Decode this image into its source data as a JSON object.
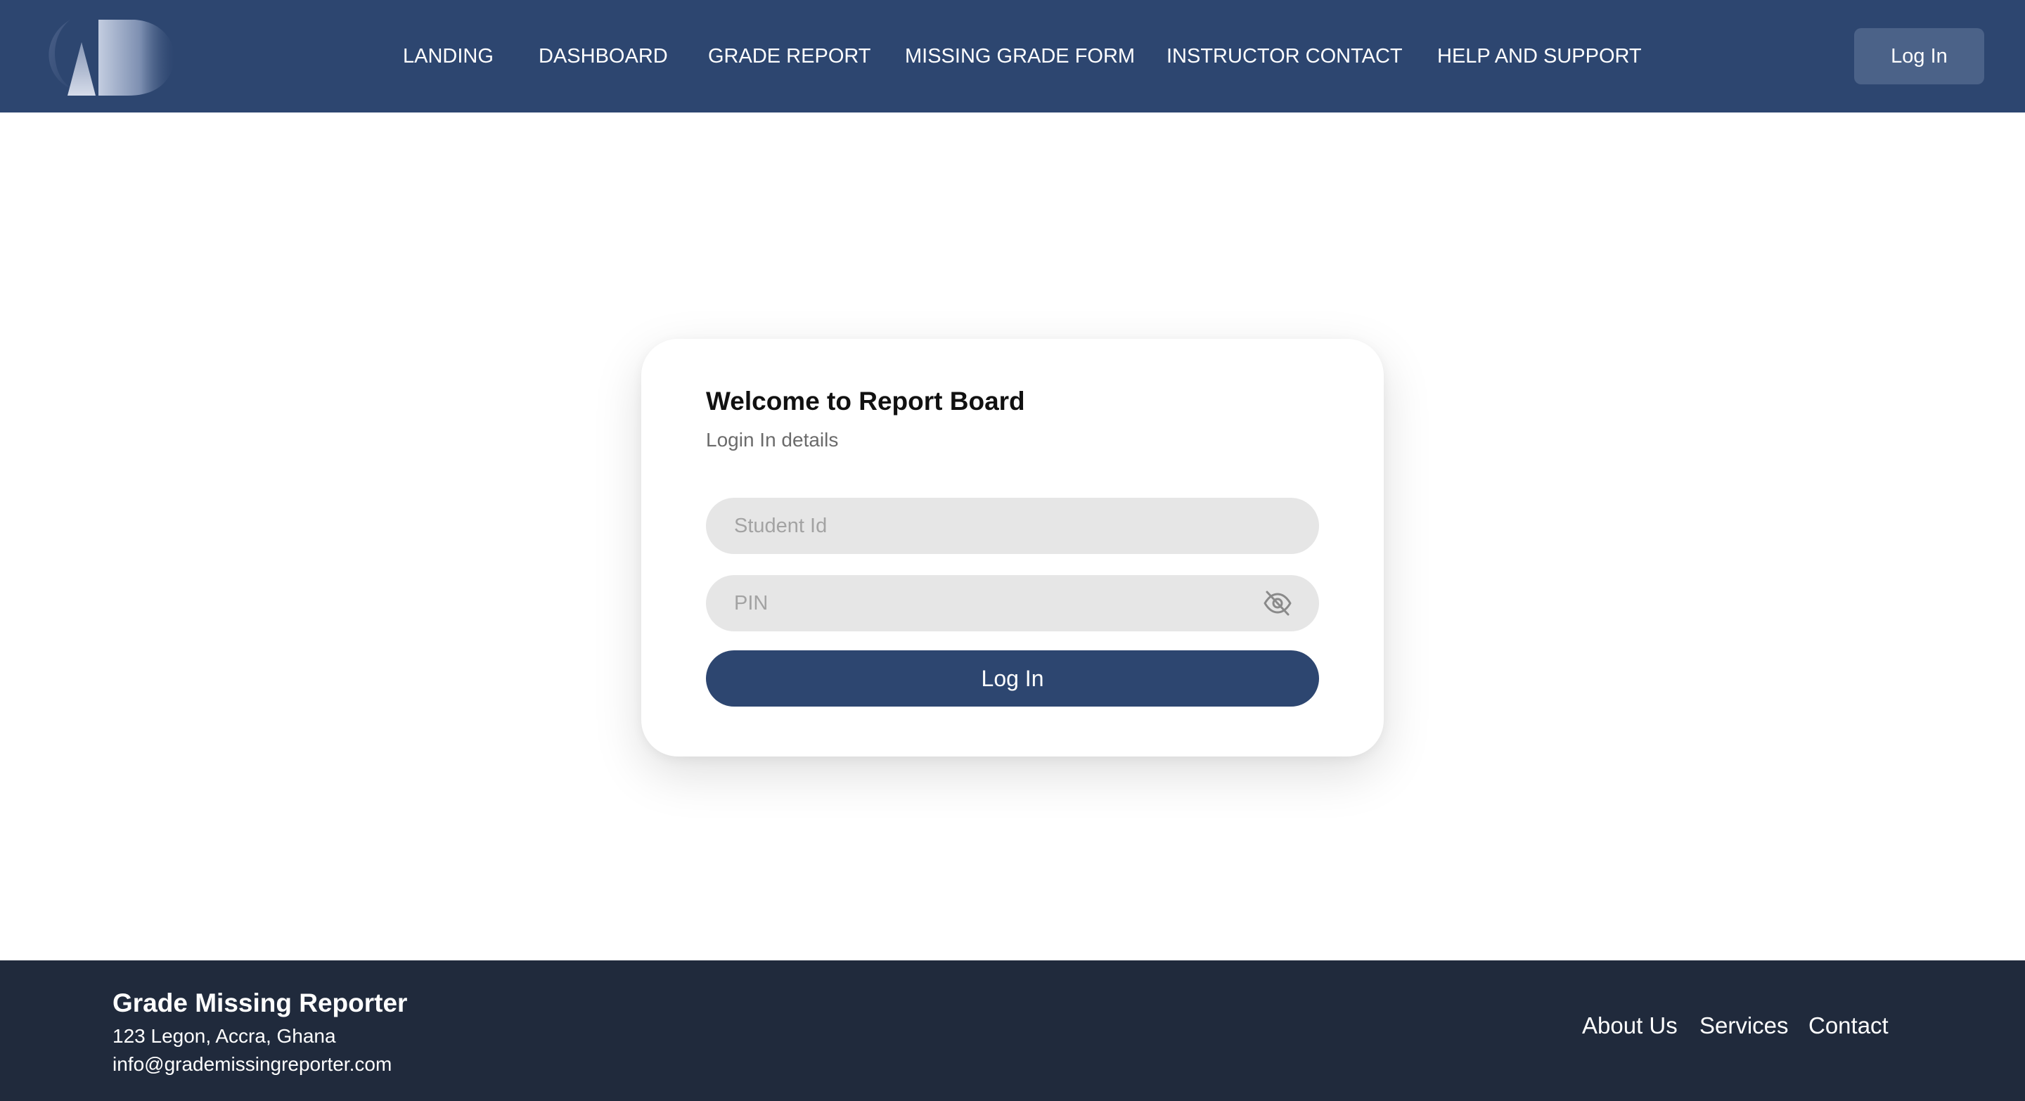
{
  "header": {
    "logo_icon": "brand-logo-icon",
    "nav": [
      {
        "label": "LANDING"
      },
      {
        "label": "DASHBOARD"
      },
      {
        "label": "GRADE REPORT"
      },
      {
        "label": "MISSING GRADE FORM"
      },
      {
        "label": "INSTRUCTOR CONTACT"
      },
      {
        "label": "HELP AND SUPPORT"
      }
    ],
    "login_label": "Log In"
  },
  "login_card": {
    "title": "Welcome to Report Board",
    "subtitle": "Login In details",
    "student_id_placeholder": "Student Id",
    "student_id_value": "",
    "pin_placeholder": "PIN",
    "pin_value": "",
    "pin_toggle_icon": "eye-slash-icon",
    "submit_label": "Log In"
  },
  "footer": {
    "brand": "Grade Missing Reporter",
    "address": "123 Legon, Accra, Ghana",
    "email": "info@grademissingreporter.com",
    "links": [
      {
        "label": "About Us"
      },
      {
        "label": "Services"
      },
      {
        "label": "Contact"
      }
    ]
  },
  "colors": {
    "header_bg": "#2d4670",
    "header_button_bg": "#4b6288",
    "primary": "#2d4670",
    "input_bg": "#e6e6e6",
    "footer_bg": "#202a3c"
  }
}
